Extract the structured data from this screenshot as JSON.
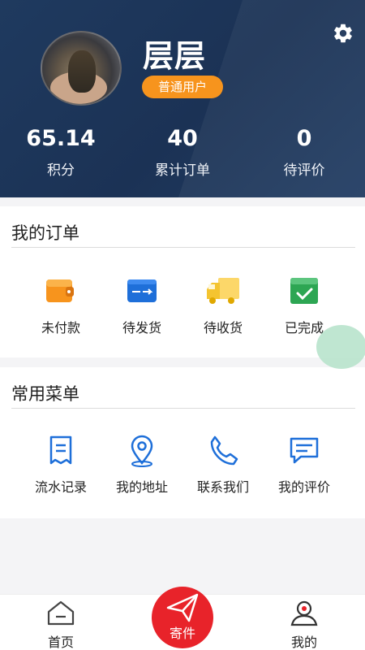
{
  "header": {
    "username": "层层",
    "user_badge": "普通用户",
    "settings_icon": "gear-icon",
    "stats": [
      {
        "value": "65.14",
        "label": "积分"
      },
      {
        "value": "40",
        "label": "累计订单"
      },
      {
        "value": "0",
        "label": "待评价"
      }
    ]
  },
  "orders": {
    "title": "我的订单",
    "items": [
      {
        "label": "未付款",
        "icon": "wallet-icon"
      },
      {
        "label": "待发货",
        "icon": "shipping-box-icon"
      },
      {
        "label": "待收货",
        "icon": "truck-icon"
      },
      {
        "label": "已完成",
        "icon": "check-box-icon"
      }
    ]
  },
  "menu": {
    "title": "常用菜单",
    "items": [
      {
        "label": "流水记录",
        "icon": "receipt-icon"
      },
      {
        "label": "我的地址",
        "icon": "location-pin-icon"
      },
      {
        "label": "联系我们",
        "icon": "phone-icon"
      },
      {
        "label": "我的评价",
        "icon": "comment-icon"
      }
    ]
  },
  "bottom_nav": {
    "home": {
      "label": "首页",
      "icon": "home-icon"
    },
    "send": {
      "label": "寄件",
      "icon": "paper-plane-icon"
    },
    "mine": {
      "label": "我的",
      "icon": "user-icon"
    }
  },
  "colors": {
    "header_bg": "#1f3a5f",
    "badge": "#f7941d",
    "accent_red": "#e8232a",
    "menu_icon_blue": "#1e6fd9"
  }
}
